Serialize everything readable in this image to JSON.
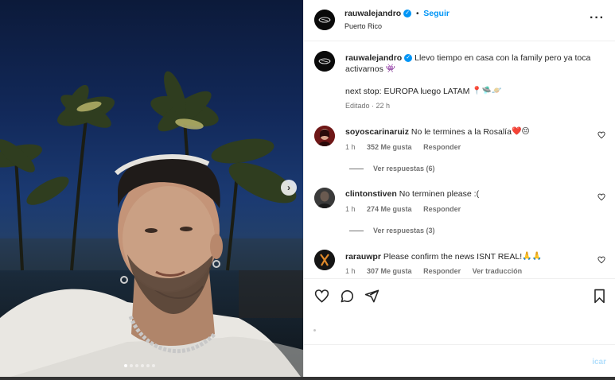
{
  "post": {
    "username": "rauwalejandro",
    "follow_label": "Seguir",
    "location": "Puerto Rico",
    "more_icon": "more-horizontal-icon"
  },
  "caption": {
    "username": "rauwalejandro",
    "text_line1": "Llevo tiempo en casa con la family pero ya toca",
    "text_line2": "activarnos",
    "emoji1": "👾",
    "text_line3": "next stop: EUROPA luego LATAM",
    "emoji2": "📍🛸🪐",
    "edited": "Editado",
    "time": "22 h"
  },
  "comments": [
    {
      "username": "soyoscarinaruiz",
      "text": "No le termines a la Rosalía",
      "emoji": "❤️😔",
      "time": "1 h",
      "likes": "352 Me gusta",
      "reply": "Responder",
      "view_replies": "Ver respuestas (6)"
    },
    {
      "username": "clintonstiven",
      "text": "No terminen please :(",
      "emoji": "",
      "time": "1 h",
      "likes": "274 Me gusta",
      "reply": "Responder",
      "view_replies": "Ver respuestas (3)"
    },
    {
      "username": "rarauwpr",
      "text": "Please confirm the news ISNT REAL!",
      "emoji": "🙏🙏",
      "time": "1 h",
      "likes": "307 Me gusta",
      "reply": "Responder",
      "translate": "Ver traducción"
    }
  ],
  "actions": {
    "like_icon": "heart-icon",
    "comment_icon": "comment-icon",
    "share_icon": "share-icon",
    "save_icon": "bookmark-icon"
  },
  "comment_box": {
    "publish_label": "icar"
  },
  "carousel": {
    "slide_count": 6,
    "active_index": 0
  }
}
